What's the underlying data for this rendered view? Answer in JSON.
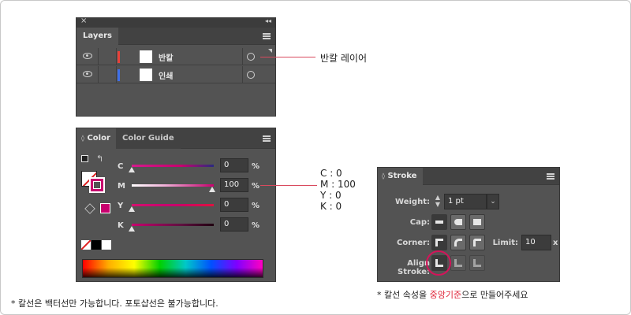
{
  "layers": {
    "tab": "Layers",
    "rows": [
      {
        "name": "반칼",
        "color": "#e8413a"
      },
      {
        "name": "인쇄",
        "color": "#3f6fe8"
      }
    ]
  },
  "layers_annotation": "반칼 레이어",
  "color": {
    "tabs": [
      "Color",
      "Color Guide"
    ],
    "channels": [
      {
        "label": "C",
        "value": "0",
        "unit": "%"
      },
      {
        "label": "M",
        "value": "100",
        "unit": "%"
      },
      {
        "label": "Y",
        "value": "0",
        "unit": "%"
      },
      {
        "label": "K",
        "value": "0",
        "unit": "%"
      }
    ],
    "fill_swatch": "#c8006e"
  },
  "color_annotation": {
    "lines": [
      "C : 0",
      "M : 100",
      "Y : 0",
      "K : 0"
    ]
  },
  "stroke": {
    "tab": "Stroke",
    "weight_label": "Weight:",
    "weight_value": "1 pt",
    "cap_label": "Cap:",
    "corner_label": "Corner:",
    "limit_label": "Limit:",
    "limit_value": "10",
    "limit_unit": "x",
    "align_label": "Align Stroke:"
  },
  "note_left": "* 칼선은 백터선만 가능합니다. 포토샵선은 불가능합니다.",
  "note_right": {
    "prefix": "* 칼선 속성을 ",
    "highlight": "중앙기준",
    "suffix": "으로 만들어주세요"
  }
}
